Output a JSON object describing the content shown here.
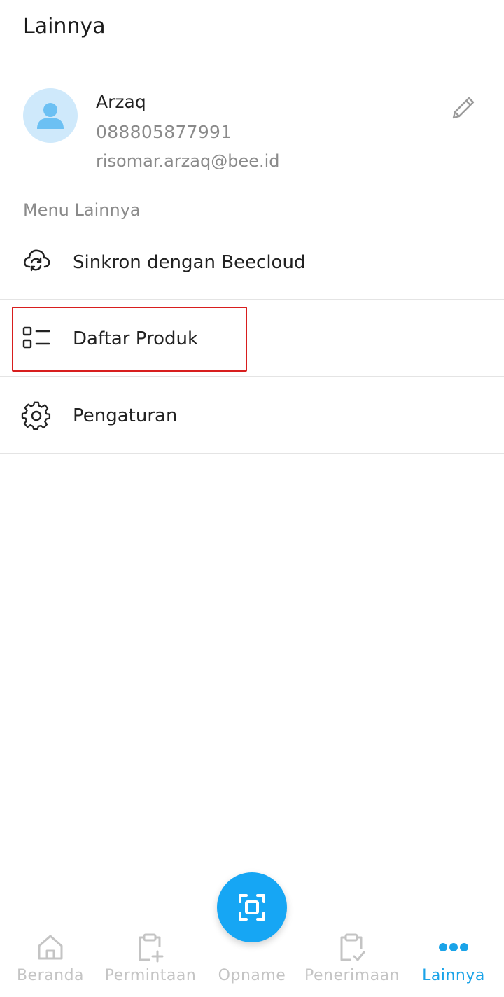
{
  "header": {
    "title": "Lainnya"
  },
  "profile": {
    "name": "Arzaq",
    "phone": "088805877991",
    "email": "risomar.arzaq@bee.id",
    "avatar_icon": "user-icon",
    "edit_icon": "pencil-icon"
  },
  "menu": {
    "section_label": "Menu Lainnya",
    "items": [
      {
        "label": "Sinkron dengan Beecloud",
        "icon": "cloud-sync-icon"
      },
      {
        "label": "Daftar Produk",
        "icon": "list-icon"
      },
      {
        "label": "Pengaturan",
        "icon": "gear-icon"
      }
    ]
  },
  "bottom_nav": {
    "items": [
      {
        "label": "Beranda",
        "icon": "home-icon"
      },
      {
        "label": "Permintaan",
        "icon": "clipboard-plus-icon"
      },
      {
        "label": "Opname",
        "icon": "scan-icon"
      },
      {
        "label": "Penerimaan",
        "icon": "clipboard-check-icon"
      },
      {
        "label": "Lainnya",
        "icon": "more-dots-icon"
      }
    ],
    "active": "Lainnya"
  },
  "colors": {
    "accent": "#16a6f4",
    "active_nav": "#1aa3e8",
    "inactive_nav": "#c4c4c4",
    "avatar_bg": "#cfe9fb",
    "highlight_border": "#d81e1e"
  }
}
